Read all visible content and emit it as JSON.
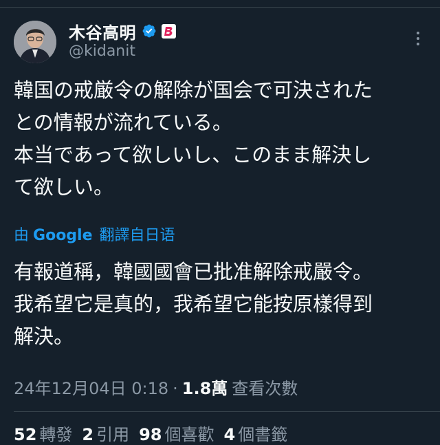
{
  "author": {
    "display_name": "木谷高明",
    "handle": "@kidanit",
    "brand_badge": "B"
  },
  "tweet": {
    "lines": [
      "韓国の戒厳令の解除が国会で可決された",
      "との情報が流れている。",
      "本当であって欲しいし、このまま解決し",
      "て欲しい。"
    ]
  },
  "translation": {
    "prefix": "由",
    "provider": "Google",
    "label": "翻譯自日语",
    "lines": [
      "有報道稱，韓國國會已批准解除戒嚴令。",
      "我希望它是真的，我希望它能按原樣得到",
      "解決。"
    ]
  },
  "meta": {
    "timestamp": "24年12月04日 0:18",
    "separator": "·",
    "views_count": "1.8萬",
    "views_label": "查看次數"
  },
  "stats": [
    {
      "count": "52",
      "label": "轉發"
    },
    {
      "count": "2",
      "label": "引用"
    },
    {
      "count": "98",
      "label": "個喜歡"
    },
    {
      "count": "4",
      "label": "個書籤"
    }
  ],
  "colors": {
    "background": "#15202b",
    "text": "#f7f9f9",
    "secondary": "#8b98a5",
    "accent": "#1d9bf0",
    "badge_red": "#e0245e"
  }
}
